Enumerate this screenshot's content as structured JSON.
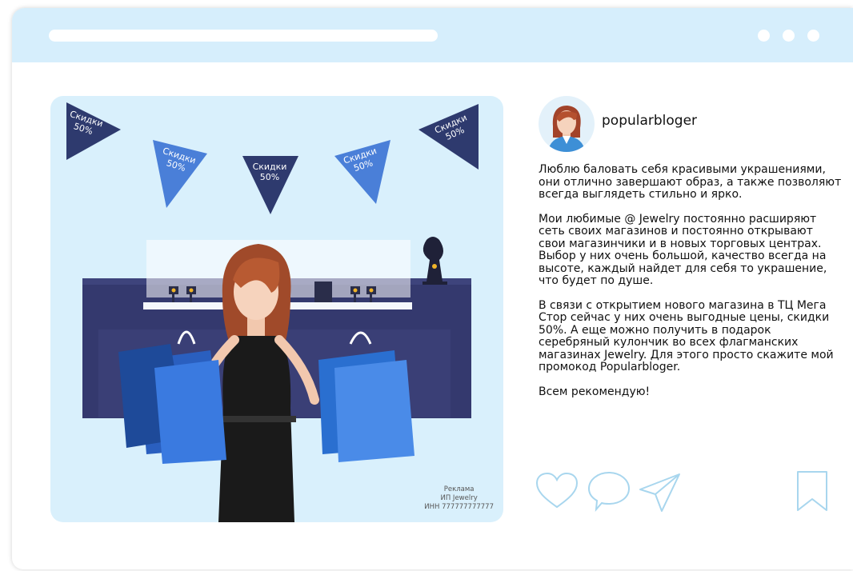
{
  "post": {
    "username": "popularbloger",
    "paragraphs": [
      "Люблю баловать себя красивыми украшениями, они отлично завершают образ, а также позволяют всегда выглядеть стильно и ярко.",
      "Мои любимые @ Jewelry постоянно расширяют сеть своих магазинов и постоянно открывают свои магазинчики и в новых торговых центрах. Выбор у них очень большой, качество всегда на высоте, каждый найдет для себя то украшение, что будет по душе.",
      "В связи с открытием нового магазина в ТЦ Мега Стор сейчас у них очень выгодные цены, скидки 50%. А еще можно получить в подарок серебряный кулончик во всех флагманских магазинах Jewelry. Для этого просто скажите мой промокод Popularbloger.",
      "Всем рекомендую!"
    ]
  },
  "image": {
    "flags": [
      {
        "line1": "Скидки",
        "line2": "50%"
      },
      {
        "line1": "Скидки",
        "line2": "50%"
      },
      {
        "line1": "Скидки",
        "line2": "50%"
      },
      {
        "line1": "Скидки",
        "line2": "50%"
      },
      {
        "line1": "Скидки",
        "line2": "50%"
      }
    ],
    "ad": {
      "line1": "Реклама",
      "line2": "ИП Jewelry",
      "line3": "ИНН 777777777777"
    }
  },
  "icons": {
    "like": "heart-icon",
    "comment": "comment-icon",
    "share": "send-icon",
    "save": "bookmark-icon"
  },
  "colors": {
    "titlebar": "#d6eefc",
    "icon_stroke": "#a8d6ee",
    "flag_dark": "#2e3a6e",
    "flag_light": "#4a7fd8"
  }
}
